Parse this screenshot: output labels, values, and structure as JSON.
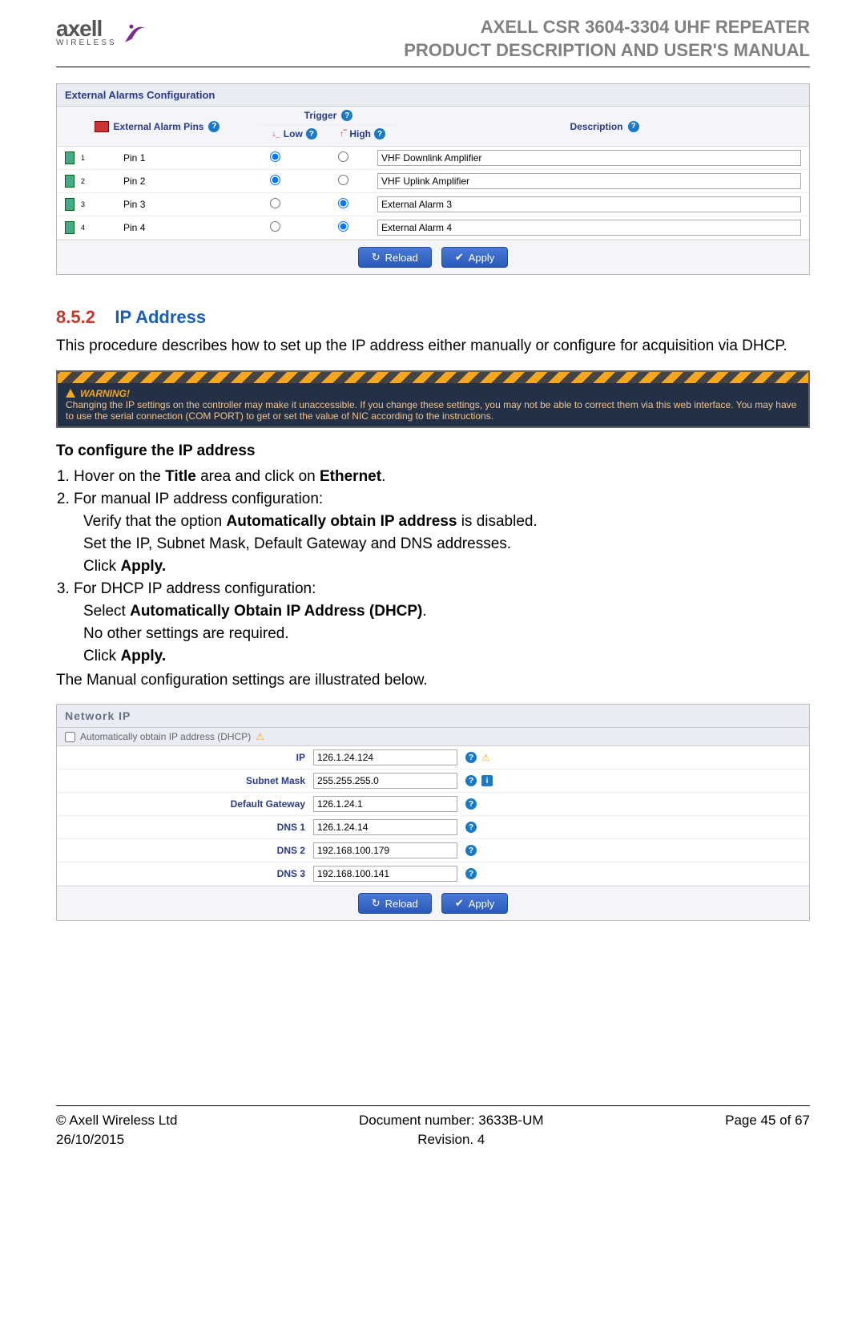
{
  "header": {
    "brand": "axell",
    "brand_sub": "WIRELESS",
    "title_line1": "AXELL CSR 3604-3304 UHF REPEATER",
    "title_line2": "PRODUCT DESCRIPTION AND USER'S MANUAL"
  },
  "alarm_panel": {
    "title": "External Alarms Configuration",
    "col_pins": "External Alarm Pins",
    "col_trigger": "Trigger",
    "col_low": "Low",
    "col_high": "High",
    "col_desc": "Description",
    "rows": [
      {
        "num": "1",
        "name": "Pin 1",
        "low": true,
        "high": false,
        "desc": "VHF Downlink Amplifier"
      },
      {
        "num": "2",
        "name": "Pin 2",
        "low": true,
        "high": false,
        "desc": "VHF Uplink Amplifier"
      },
      {
        "num": "3",
        "name": "Pin 3",
        "low": false,
        "high": true,
        "desc": "External Alarm 3"
      },
      {
        "num": "4",
        "name": "Pin 4",
        "low": false,
        "high": true,
        "desc": "External Alarm 4"
      }
    ],
    "btn_reload": "Reload",
    "btn_apply": "Apply"
  },
  "section": {
    "num": "8.5.2",
    "title": "IP Address",
    "intro": "This procedure describes how to set up the IP address either manually or configure for acquisition via DHCP."
  },
  "warning": {
    "title": "WARNING!",
    "body": "Changing the IP settings on the controller may make it unaccessible. If you change these settings, you may not be able to correct them via this web interface. You may have to use the serial connection (COM PORT) to get or set the value of NIC according to the instructions."
  },
  "steps": {
    "heading": "To configure the IP address",
    "s1_a": "Hover on the ",
    "s1_b": "Title",
    "s1_c": " area and click on ",
    "s1_d": "Ethernet",
    "s1_e": ".",
    "s2": "For manual IP address configuration:",
    "s2a_a": "Verify that the option ",
    "s2a_b": "Automatically obtain IP address",
    "s2a_c": " is disabled.",
    "s2b": "Set the IP, Subnet Mask, Default Gateway and DNS addresses.",
    "s2c_a": "Click ",
    "s2c_b": "Apply.",
    "s3": "For DHCP IP address configuration:",
    "s3a_a": "Select ",
    "s3a_b": "Automatically Obtain IP Address (DHCP)",
    "s3a_c": ".",
    "s3b": "No other settings are required.",
    "s3c_a": "Click ",
    "s3c_b": "Apply.",
    "tail": "The Manual configuration settings are illustrated below."
  },
  "netpanel": {
    "title": "Network IP",
    "dhcp_label": "Automatically obtain IP address (DHCP)",
    "rows": [
      {
        "label": "IP",
        "value": "126.1.24.124",
        "warn": true,
        "info": false
      },
      {
        "label": "Subnet Mask",
        "value": "255.255.255.0",
        "warn": false,
        "info": true
      },
      {
        "label": "Default Gateway",
        "value": "126.1.24.1",
        "warn": false,
        "info": false
      },
      {
        "label": "DNS 1",
        "value": "126.1.24.14",
        "warn": false,
        "info": false
      },
      {
        "label": "DNS 2",
        "value": "192.168.100.179",
        "warn": false,
        "info": false
      },
      {
        "label": "DNS 3",
        "value": "192.168.100.141",
        "warn": false,
        "info": false
      }
    ],
    "btn_reload": "Reload",
    "btn_apply": "Apply"
  },
  "footer": {
    "l1": "© Axell Wireless Ltd",
    "l2": "26/10/2015",
    "c1": "Document number: 3633B-UM",
    "c2": "Revision. 4",
    "r1": "Page 45 of 67"
  }
}
